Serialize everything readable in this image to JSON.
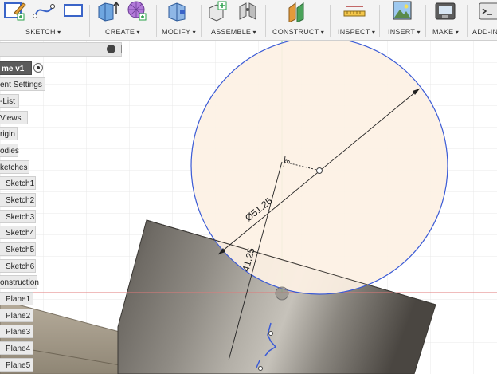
{
  "toolbar": {
    "groups": [
      {
        "label": "SKETCH"
      },
      {
        "label": "CREATE"
      },
      {
        "label": "MODIFY"
      },
      {
        "label": "ASSEMBLE"
      },
      {
        "label": "CONSTRUCT"
      },
      {
        "label": "INSPECT"
      },
      {
        "label": "INSERT"
      },
      {
        "label": "MAKE"
      },
      {
        "label": "ADD-IN"
      }
    ]
  },
  "browser": {
    "root": "me v1",
    "items": [
      "ent Settings",
      "-List",
      "Views",
      "rigin",
      "odies",
      "ketches",
      "Sketch1",
      "Sketch2",
      "Sketch3",
      "Sketch4",
      "Sketch5",
      "Sketch6",
      "onstruction",
      "Plane1",
      "Plane2",
      "Plane3",
      "Plane4",
      "Plane5"
    ]
  },
  "canvas": {
    "dimension_diameter": "Ø51.25",
    "dimension_length": "41.25",
    "dimension_small": "3",
    "colors": {
      "sketch_fill": "#fdf1e4",
      "sketch_curve": "#3b5bd6",
      "body_dark": "#5a5650",
      "body_light": "#a6a29a",
      "axis_green": "#7fcf7f",
      "axis_red": "#e07a7a"
    }
  }
}
